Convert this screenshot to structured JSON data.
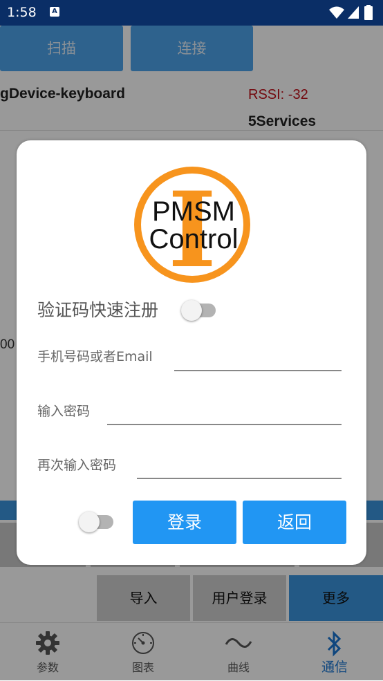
{
  "status_bar": {
    "time": "1:58",
    "notif_icon": "A"
  },
  "background": {
    "buttons": [
      "扫描",
      "连接"
    ],
    "device_name": "gDevice-keyboard",
    "rssi": "RSSI: -32",
    "services": "5Services",
    "number_fragment": "00",
    "bottom_buttons": [
      "导入",
      "用户登录",
      "更多"
    ],
    "nav": [
      {
        "label": "参数",
        "icon": "gear-icon"
      },
      {
        "label": "图表",
        "icon": "gauge-icon"
      },
      {
        "label": "曲线",
        "icon": "wave-icon"
      },
      {
        "label": "通信",
        "icon": "bluetooth-icon"
      }
    ]
  },
  "dialog": {
    "logo_text_line1": "PMSM",
    "logo_text_line2": "Control",
    "logo_letter": "I",
    "quick_register_label": "验证码快速注册",
    "quick_register_on": false,
    "fields": [
      {
        "label": "手机号码或者Email",
        "value": ""
      },
      {
        "label": "输入密码",
        "value": ""
      },
      {
        "label": "再次输入密码",
        "value": ""
      }
    ],
    "remember_on": false,
    "login_label": "登录",
    "back_label": "返回"
  },
  "colors": {
    "accent": "#2196f3",
    "logo_orange": "#f7941d",
    "status_bar": "#0a2e66"
  }
}
